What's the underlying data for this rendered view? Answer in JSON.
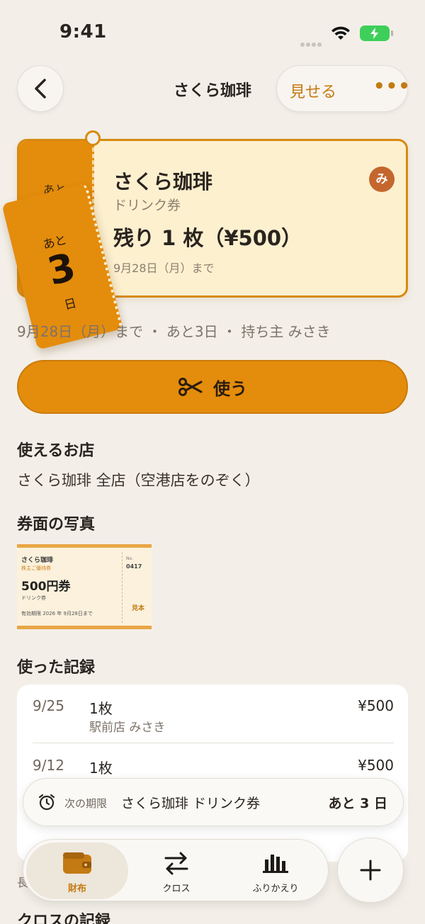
{
  "status": {
    "time": "9:41"
  },
  "nav": {
    "title": "さくら珈琲",
    "show": "見せる",
    "more": "•••"
  },
  "card": {
    "stub_label": "あと",
    "name": "さくら珈琲",
    "kind": "ドリンク券",
    "remain": "残り 1 枚（¥500）",
    "until": "9月28日（月）まで",
    "owner_initial": "み",
    "torn_top": "あと",
    "torn_number": "3",
    "torn_unit": "日"
  },
  "meta": "9月28日（月）まで ・ あと3日 ・ 持ち主 みさき",
  "use_button": "使う",
  "stores": {
    "heading": "使えるお店",
    "text": "さくら珈琲 全店（空港店をのぞく）"
  },
  "photo": {
    "heading": "券面の写真",
    "brand": "さくら珈琲",
    "tag": "株主ご優待券",
    "amount": "500円券",
    "kind": "ドリンク券",
    "expiry": "有効期限 2026 年 9月28日まで",
    "no_label": "No.",
    "no": "0417",
    "sample": "見本"
  },
  "history": {
    "heading": "使った記録",
    "rows": [
      {
        "date": "9/25",
        "count": "1枚",
        "sub": "駅前店  みさき",
        "amount": "¥500"
      },
      {
        "date": "9/12",
        "count": "1枚",
        "sub": "",
        "amount": "¥500"
      }
    ]
  },
  "next_banner": {
    "label": "次の期限",
    "value": "さくら珈琲 ドリンク券",
    "days": "あと 3 日"
  },
  "footer_text": "長",
  "cross_heading": "クロスの記録",
  "tabs": [
    {
      "label": "財布",
      "icon": "wallet-icon"
    },
    {
      "label": "クロス",
      "icon": "swap-arrows-icon"
    },
    {
      "label": "ふりかえり",
      "icon": "bar-chart-icon"
    }
  ],
  "colors": {
    "accent": "#e48c0c",
    "accent_text": "#c47a12",
    "card_bg": "#fdf0cf",
    "background": "#f3efe8",
    "owner_badge": "#c4672e"
  }
}
